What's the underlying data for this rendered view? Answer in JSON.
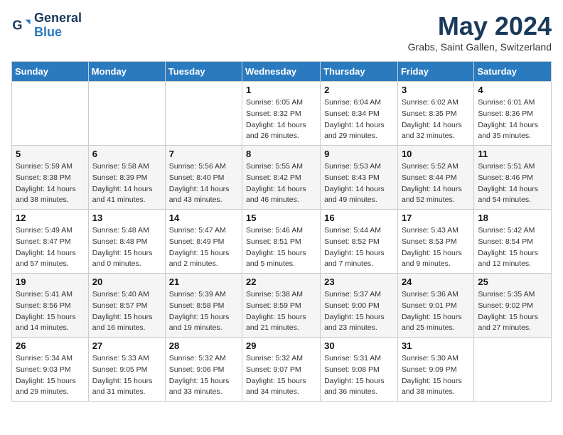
{
  "logo": {
    "line1": "General",
    "line2": "Blue"
  },
  "title": "May 2024",
  "location": "Grabs, Saint Gallen, Switzerland",
  "weekdays": [
    "Sunday",
    "Monday",
    "Tuesday",
    "Wednesday",
    "Thursday",
    "Friday",
    "Saturday"
  ],
  "weeks": [
    [
      null,
      null,
      null,
      {
        "day": "1",
        "sunrise": "6:05 AM",
        "sunset": "8:32 PM",
        "daylight": "14 hours and 26 minutes."
      },
      {
        "day": "2",
        "sunrise": "6:04 AM",
        "sunset": "8:34 PM",
        "daylight": "14 hours and 29 minutes."
      },
      {
        "day": "3",
        "sunrise": "6:02 AM",
        "sunset": "8:35 PM",
        "daylight": "14 hours and 32 minutes."
      },
      {
        "day": "4",
        "sunrise": "6:01 AM",
        "sunset": "8:36 PM",
        "daylight": "14 hours and 35 minutes."
      }
    ],
    [
      {
        "day": "5",
        "sunrise": "5:59 AM",
        "sunset": "8:38 PM",
        "daylight": "14 hours and 38 minutes."
      },
      {
        "day": "6",
        "sunrise": "5:58 AM",
        "sunset": "8:39 PM",
        "daylight": "14 hours and 41 minutes."
      },
      {
        "day": "7",
        "sunrise": "5:56 AM",
        "sunset": "8:40 PM",
        "daylight": "14 hours and 43 minutes."
      },
      {
        "day": "8",
        "sunrise": "5:55 AM",
        "sunset": "8:42 PM",
        "daylight": "14 hours and 46 minutes."
      },
      {
        "day": "9",
        "sunrise": "5:53 AM",
        "sunset": "8:43 PM",
        "daylight": "14 hours and 49 minutes."
      },
      {
        "day": "10",
        "sunrise": "5:52 AM",
        "sunset": "8:44 PM",
        "daylight": "14 hours and 52 minutes."
      },
      {
        "day": "11",
        "sunrise": "5:51 AM",
        "sunset": "8:46 PM",
        "daylight": "14 hours and 54 minutes."
      }
    ],
    [
      {
        "day": "12",
        "sunrise": "5:49 AM",
        "sunset": "8:47 PM",
        "daylight": "14 hours and 57 minutes."
      },
      {
        "day": "13",
        "sunrise": "5:48 AM",
        "sunset": "8:48 PM",
        "daylight": "15 hours and 0 minutes."
      },
      {
        "day": "14",
        "sunrise": "5:47 AM",
        "sunset": "8:49 PM",
        "daylight": "15 hours and 2 minutes."
      },
      {
        "day": "15",
        "sunrise": "5:46 AM",
        "sunset": "8:51 PM",
        "daylight": "15 hours and 5 minutes."
      },
      {
        "day": "16",
        "sunrise": "5:44 AM",
        "sunset": "8:52 PM",
        "daylight": "15 hours and 7 minutes."
      },
      {
        "day": "17",
        "sunrise": "5:43 AM",
        "sunset": "8:53 PM",
        "daylight": "15 hours and 9 minutes."
      },
      {
        "day": "18",
        "sunrise": "5:42 AM",
        "sunset": "8:54 PM",
        "daylight": "15 hours and 12 minutes."
      }
    ],
    [
      {
        "day": "19",
        "sunrise": "5:41 AM",
        "sunset": "8:56 PM",
        "daylight": "15 hours and 14 minutes."
      },
      {
        "day": "20",
        "sunrise": "5:40 AM",
        "sunset": "8:57 PM",
        "daylight": "15 hours and 16 minutes."
      },
      {
        "day": "21",
        "sunrise": "5:39 AM",
        "sunset": "8:58 PM",
        "daylight": "15 hours and 19 minutes."
      },
      {
        "day": "22",
        "sunrise": "5:38 AM",
        "sunset": "8:59 PM",
        "daylight": "15 hours and 21 minutes."
      },
      {
        "day": "23",
        "sunrise": "5:37 AM",
        "sunset": "9:00 PM",
        "daylight": "15 hours and 23 minutes."
      },
      {
        "day": "24",
        "sunrise": "5:36 AM",
        "sunset": "9:01 PM",
        "daylight": "15 hours and 25 minutes."
      },
      {
        "day": "25",
        "sunrise": "5:35 AM",
        "sunset": "9:02 PM",
        "daylight": "15 hours and 27 minutes."
      }
    ],
    [
      {
        "day": "26",
        "sunrise": "5:34 AM",
        "sunset": "9:03 PM",
        "daylight": "15 hours and 29 minutes."
      },
      {
        "day": "27",
        "sunrise": "5:33 AM",
        "sunset": "9:05 PM",
        "daylight": "15 hours and 31 minutes."
      },
      {
        "day": "28",
        "sunrise": "5:32 AM",
        "sunset": "9:06 PM",
        "daylight": "15 hours and 33 minutes."
      },
      {
        "day": "29",
        "sunrise": "5:32 AM",
        "sunset": "9:07 PM",
        "daylight": "15 hours and 34 minutes."
      },
      {
        "day": "30",
        "sunrise": "5:31 AM",
        "sunset": "9:08 PM",
        "daylight": "15 hours and 36 minutes."
      },
      {
        "day": "31",
        "sunrise": "5:30 AM",
        "sunset": "9:09 PM",
        "daylight": "15 hours and 38 minutes."
      },
      null
    ]
  ],
  "labels": {
    "sunrise": "Sunrise:",
    "sunset": "Sunset:",
    "daylight": "Daylight:"
  }
}
